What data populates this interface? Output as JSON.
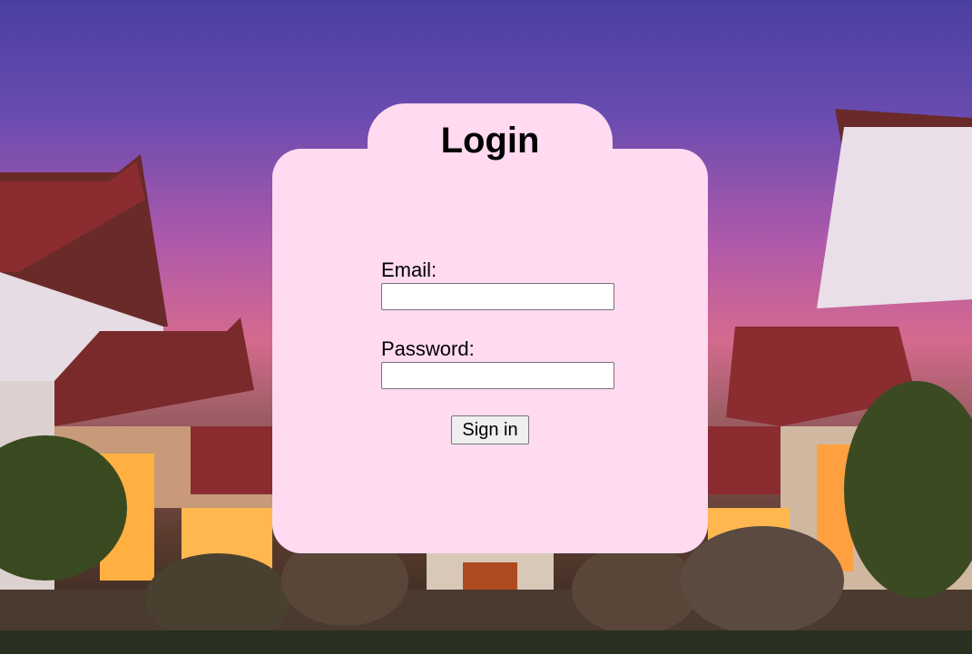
{
  "login": {
    "title": "Login",
    "email_label": "Email:",
    "email_value": "",
    "password_label": "Password:",
    "password_value": "",
    "submit_label": "Sign in"
  },
  "colors": {
    "card_background": "#ffdaf0",
    "button_background": "#efefef"
  }
}
